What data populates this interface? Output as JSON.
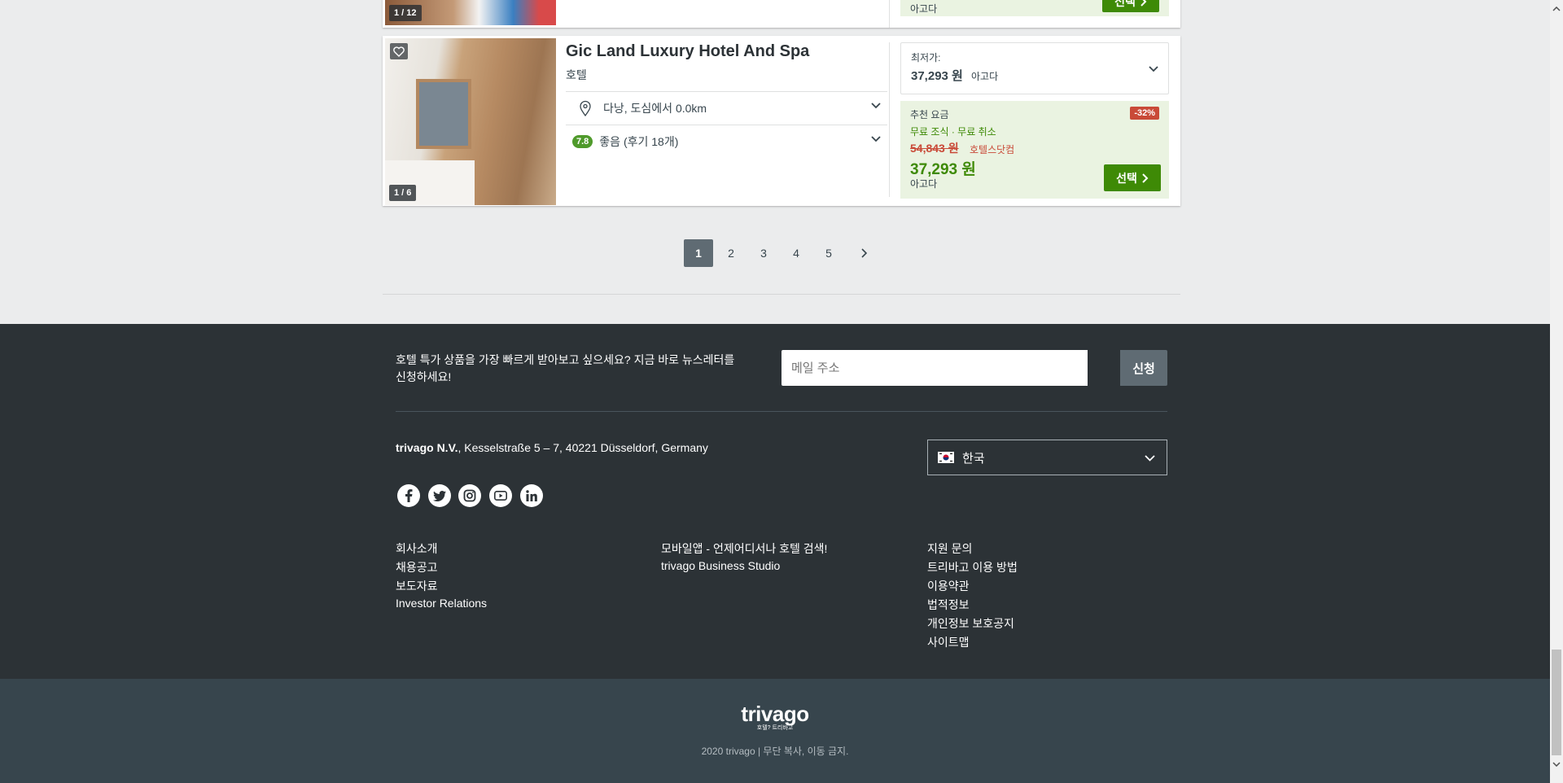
{
  "hotel_prev": {
    "image_counter": "1 / 12",
    "booking_site": "아고다",
    "select_label": "선택"
  },
  "hotel": {
    "name": "Gic Land Luxury Hotel And Spa",
    "type": "호텔",
    "image_counter": "1 / 6",
    "location": "다낭, 도심에서 0.0km",
    "rating_score": "7.8",
    "rating_text": "좋음 (후기 18개)",
    "lowest_label": "최저가:",
    "lowest_price": "37,293 원",
    "lowest_site": "아고다",
    "reco_label": "추천 요금",
    "discount": "-32%",
    "amenities": "무료 조식 · 무료 취소",
    "old_price": "54,843 원",
    "old_price_site": "호텔스닷컴",
    "price": "37,293 원",
    "price_site": "아고다",
    "select_label": "선택"
  },
  "pagination": {
    "pages": [
      "1",
      "2",
      "3",
      "4",
      "5"
    ],
    "active_page": "1"
  },
  "footer": {
    "newsletter_text_1": "호텔 특가 상품을 가장 빠르게 받아보고 싶으세요? 지금 바로 뉴스레터를",
    "newsletter_text_2": "신청하세요!",
    "email_placeholder": "메일 주소",
    "subscribe_label": "신청",
    "company_name": "trivago N.V.",
    "company_address": ", Kesselstraße 5 – 7, 40221 Düsseldorf, Germany",
    "country_selected": "한국",
    "col1": [
      "회사소개",
      "채용공고",
      "보도자료",
      "Investor Relations"
    ],
    "col2": [
      "모바일앱 - 언제어디서나 호텔 검색!",
      "trivago Business Studio"
    ],
    "col3": [
      "지원 문의",
      "트리바고 이용 방법",
      "이용약관",
      "법적정보",
      "개인정보 보호공지",
      "사이트맵"
    ],
    "logo_text": "trivago",
    "logo_tagline": "호텔? 트리바고",
    "copyright": "2020 trivago | 무단 복사, 이동 금지."
  },
  "colors": {
    "accent_green": "#3e8a06",
    "discount_red": "#c94a38",
    "footer_dark": "#2c3236"
  }
}
